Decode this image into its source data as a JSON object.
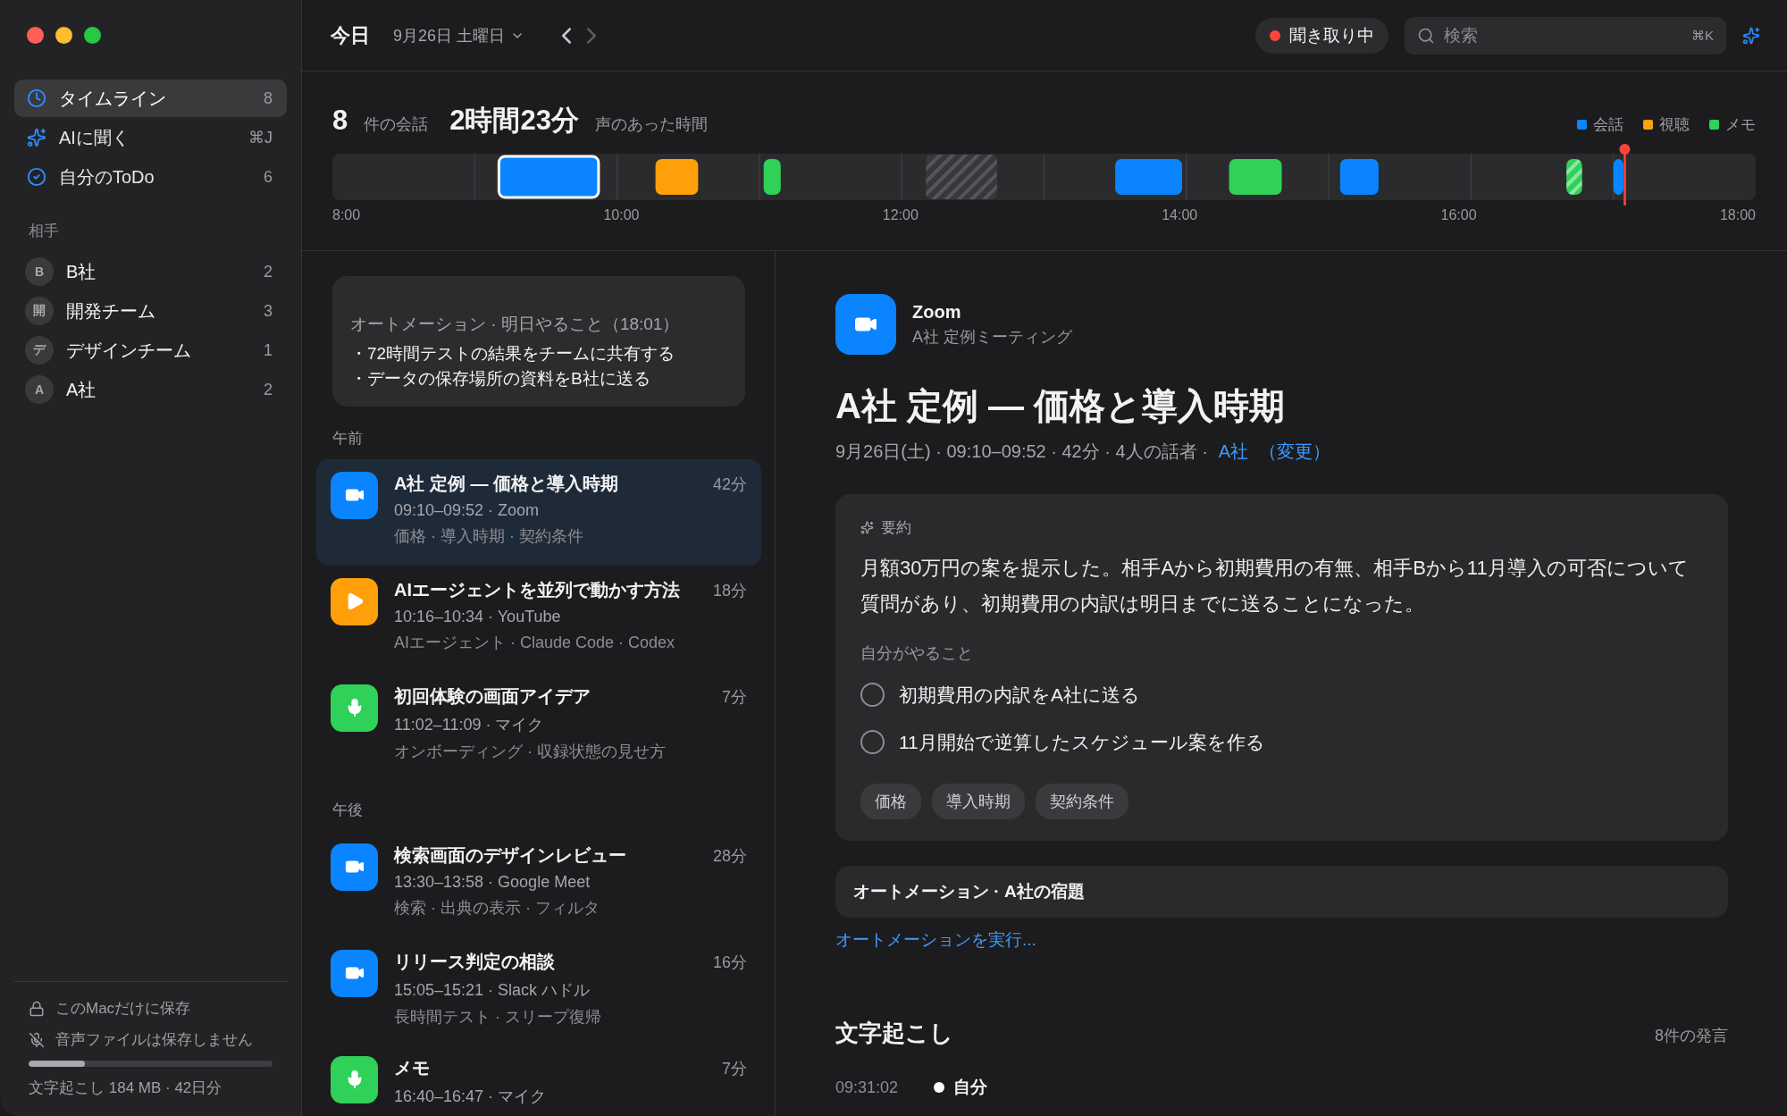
{
  "sidebar": {
    "nav": [
      {
        "label": "タイムライン",
        "trailing": "8",
        "selected": true
      },
      {
        "label": "AIに聞く",
        "trailing": "⌘J",
        "selected": false
      },
      {
        "label": "自分のToDo",
        "trailing": "6",
        "selected": false
      }
    ],
    "contacts_heading": "相手",
    "contacts": [
      {
        "avatar": "B",
        "name": "B社",
        "count": "2"
      },
      {
        "avatar": "開",
        "name": "開発チーム",
        "count": "3"
      },
      {
        "avatar": "デ",
        "name": "デザインチーム",
        "count": "1"
      },
      {
        "avatar": "A",
        "name": "A社",
        "count": "2"
      }
    ],
    "footer": {
      "local_only": "このMacだけに保存",
      "no_audio": "音声ファイルは保存しません",
      "storage": {
        "level": 0.23
      },
      "storage_caption": "文字起こし 184 MB · 42日分"
    }
  },
  "header": {
    "title": "今日",
    "date": "9月26日 土曜日",
    "next_disabled": true,
    "listening": "聞き取り中",
    "search": {
      "placeholder": "検索",
      "shortcut": "⌘K"
    }
  },
  "stats": {
    "count": "8",
    "count_label": "件の会話",
    "duration": "2時間23分",
    "duration_label": "声のあった時間",
    "legend": [
      {
        "label": "会話",
        "color": "#0a84ff"
      },
      {
        "label": "視聴",
        "color": "#ff9f0a"
      },
      {
        "label": "メモ",
        "color": "#30d158"
      }
    ]
  },
  "timeline": {
    "ticks": [
      "8:00",
      "10:00",
      "12:00",
      "14:00",
      "16:00",
      "18:00"
    ],
    "segments": [
      {
        "kind": "conversation",
        "selected": true,
        "striped": false
      },
      {
        "kind": "viewing",
        "selected": false,
        "striped": false
      },
      {
        "kind": "memo",
        "selected": false,
        "striped": false
      },
      {
        "kind": "idle",
        "selected": false,
        "striped": true
      },
      {
        "kind": "conversation",
        "selected": false,
        "striped": false
      },
      {
        "kind": "memo",
        "selected": false,
        "striped": false
      },
      {
        "kind": "conversation",
        "selected": false,
        "striped": false
      },
      {
        "kind": "memo",
        "selected": false,
        "striped": true
      },
      {
        "kind": "conversation",
        "selected": false,
        "striped": false
      }
    ]
  },
  "automation_card": {
    "title": "オートメーション · 明日やること（18:01）",
    "lines": [
      "・72時間テストの結果をチームに共有する",
      "・データの保存場所の資料をB社に送る"
    ]
  },
  "sections": [
    {
      "heading": "午前",
      "items": [
        {
          "kind": "video",
          "title": "A社 定例 — 価格と導入時期",
          "duration": "42分",
          "meta": "09:10–09:52 · Zoom",
          "tags": "価格 · 導入時期 · 契約条件",
          "selected": true
        },
        {
          "kind": "play",
          "title": "AIエージェントを並列で動かす方法",
          "duration": "18分",
          "meta": "10:16–10:34 · YouTube",
          "tags": "AIエージェント · Claude Code · Codex",
          "selected": false
        },
        {
          "kind": "mic",
          "title": "初回体験の画面アイデア",
          "duration": "7分",
          "meta": "11:02–11:09 · マイク",
          "tags": "オンボーディング · 収録状態の見せ方",
          "selected": false
        }
      ]
    },
    {
      "heading": "午後",
      "items": [
        {
          "kind": "video",
          "title": "検索画面のデザインレビュー",
          "duration": "28分",
          "meta": "13:30–13:58 · Google Meet",
          "tags": "検索 · 出典の表示 · フィルタ",
          "selected": false
        },
        {
          "kind": "video",
          "title": "リリース判定の相談",
          "duration": "16分",
          "meta": "15:05–15:21 · Slack ハドル",
          "tags": "長時間テスト · スリープ復帰",
          "selected": false
        },
        {
          "kind": "mic",
          "title": "メモ",
          "duration": "7分",
          "meta": "16:40–16:47 · マイク",
          "selected": false
        }
      ]
    }
  ],
  "detail": {
    "app": "Zoom",
    "app_subtitle": "A社 定例ミーティング",
    "title": "A社 定例 — 価格と導入時期",
    "meta": "9月26日(土) · 09:10–09:52 · 42分 · 4人の話者 ·",
    "contact_link": "A社",
    "change_link": "（変更）",
    "summary": {
      "label": "要約",
      "text": "月額30万円の案を提示した。相手Aから初期費用の有無、相手Bから11月導入の可否について質問があり、初期費用の内訳は明日までに送ることになった。",
      "todo_heading": "自分がやること",
      "todos": [
        {
          "label": "初期費用の内訳をA社に送る",
          "checked": false
        },
        {
          "label": "11月開始で逆算したスケジュール案を作る",
          "checked": false
        }
      ],
      "tags": [
        "価格",
        "導入時期",
        "契約条件"
      ]
    },
    "automation": "オートメーション · A社の宿題",
    "run_link": "オートメーションを実行...",
    "transcript": {
      "heading": "文字起こし",
      "count": "8件の発言",
      "rows": [
        {
          "time": "09:31:02",
          "speaker": "自分"
        }
      ]
    }
  }
}
